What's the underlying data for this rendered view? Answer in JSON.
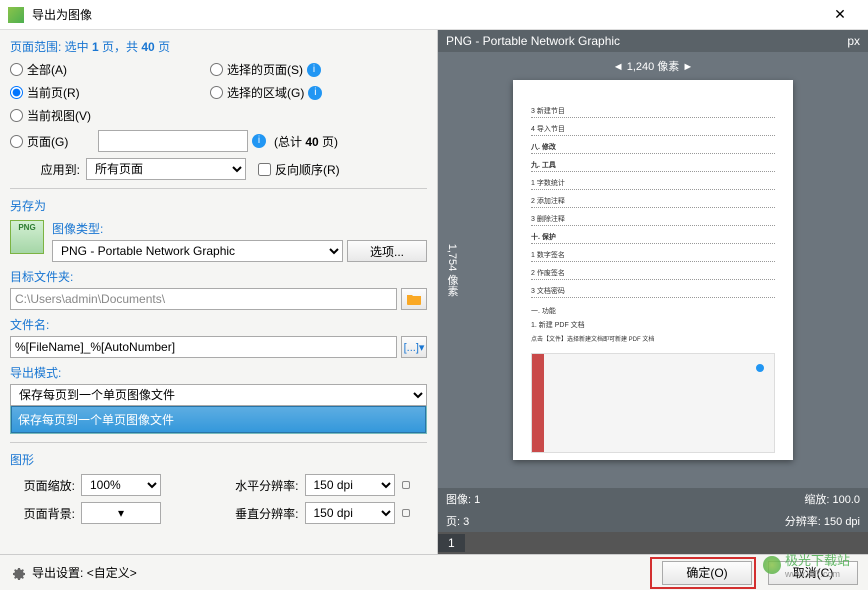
{
  "window": {
    "title": "导出为图像"
  },
  "pageRange": {
    "label_prefix": "页面范围: 选中 ",
    "selected_count": "1",
    "label_mid": " 页，共 ",
    "total_count": "40",
    "label_suffix": " 页"
  },
  "radios": {
    "all": "全部(A)",
    "current_page": "当前页(R)",
    "current_view": "当前视图(V)",
    "pages": "页面(G)",
    "selected_pages": "选择的页面(S)",
    "selected_area": "选择的区域(G)"
  },
  "pages_total_prefix": "(总计 ",
  "pages_total_count": "40",
  "pages_total_suffix": " 页)",
  "apply_to_label": "应用到:",
  "apply_to_value": "所有页面",
  "reverse_order": "反向顺序(R)",
  "save_as_label": "另存为",
  "image_type_label": "图像类型:",
  "image_type_value": "PNG - Portable Network Graphic",
  "options_btn": "选项...",
  "dest_folder_label": "目标文件夹:",
  "dest_folder_value": "C:\\Users\\admin\\Documents\\",
  "filename_label": "文件名:",
  "filename_value": "%[FileName]_%[AutoNumber]",
  "export_mode_label": "导出模式:",
  "export_mode_value": "保存每页到一个单页图像文件",
  "export_mode_option": "保存每页到一个单页图像文件",
  "graphics_label": "图形",
  "page_zoom_label": "页面缩放:",
  "page_zoom_value": "100%",
  "page_bg_label": "页面背景:",
  "hres_label": "水平分辨率:",
  "hres_value": "150 dpi",
  "vres_label": "垂直分辨率:",
  "vres_value": "150 dpi",
  "preview": {
    "header_left": "PNG - Portable Network Graphic",
    "header_right": "px",
    "width_label": "1,240 像素",
    "height_label": "1,754 像素",
    "footer_image": "图像: 1",
    "footer_zoom": "缩放: 100.0",
    "footer_pages": "页: 3",
    "footer_res": "分辨率: 150 dpi",
    "indicator": "1",
    "toc": {
      "l1": "3  新建节目",
      "l2": "4  导入节目",
      "l3": "八. 修改",
      "l4": "九. 工具",
      "l5": "1  字数统计",
      "l6": "2  添加注释",
      "l7": "3  删除注释",
      "l8": "十. 保护",
      "l9": "1  数字签名",
      "l10": "2  作废签名",
      "l11": "3  文档密码",
      "l12": "一. 功能",
      "l13": "1. 新建 PDF 文档",
      "l14": "点击【文件】选择新建文档即可新建 PDF 文档"
    }
  },
  "bottom": {
    "settings_label": "导出设置:",
    "settings_value": "<自定义>",
    "ok": "确定(O)",
    "cancel": "取消(C)"
  },
  "watermark": {
    "text": "极光下载站",
    "url": "www.xz7.com"
  }
}
